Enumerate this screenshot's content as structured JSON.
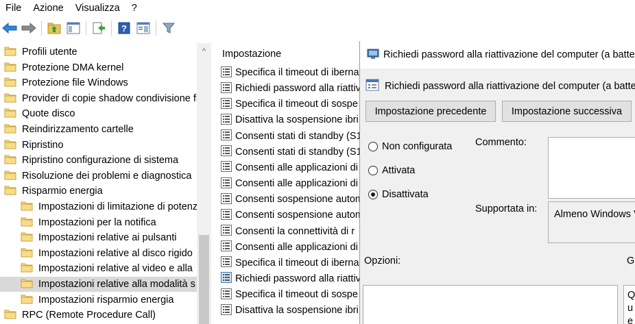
{
  "menu": [
    "File",
    "Azione",
    "Visualizza",
    "?"
  ],
  "toolbar_icons": [
    "back-arrow-icon",
    "forward-arrow-icon",
    "up-folder-icon",
    "show-hide-tree-icon",
    "export-list-icon",
    "help-icon",
    "properties-icon",
    "filter-icon"
  ],
  "tree": {
    "items": [
      {
        "label": "Profili utente",
        "indent": 0
      },
      {
        "label": "Protezione DMA kernel",
        "indent": 0
      },
      {
        "label": "Protezione file Windows",
        "indent": 0
      },
      {
        "label": "Provider di copie shadow condivisione file",
        "indent": 0
      },
      {
        "label": "Quote disco",
        "indent": 0
      },
      {
        "label": "Reindirizzamento cartelle",
        "indent": 0
      },
      {
        "label": "Ripristino",
        "indent": 0
      },
      {
        "label": "Ripristino configurazione di sistema",
        "indent": 0
      },
      {
        "label": "Risoluzione dei problemi e diagnostica",
        "indent": 0
      },
      {
        "label": "Risparmio energia",
        "indent": 0
      },
      {
        "label": "Impostazioni di limitazione di potenza",
        "indent": 1
      },
      {
        "label": "Impostazioni per la notifica",
        "indent": 1
      },
      {
        "label": "Impostazioni relative ai pulsanti",
        "indent": 1
      },
      {
        "label": "Impostazioni relative al disco rigido",
        "indent": 1
      },
      {
        "label": "Impostazioni relative al video e alla",
        "indent": 1
      },
      {
        "label": "Impostazioni relative alla modalità s",
        "indent": 1,
        "selected": true
      },
      {
        "label": "Impostazioni risparmio energia",
        "indent": 1
      },
      {
        "label": "RPC (Remote Procedure Call)",
        "indent": 0
      }
    ]
  },
  "list": {
    "header": "Impostazione",
    "items": [
      {
        "label": "Specifica il timeout di iberna"
      },
      {
        "label": "Richiedi password alla riattiv"
      },
      {
        "label": "Specifica il timeout di sospe"
      },
      {
        "label": "Disattiva la sospensione ibri"
      },
      {
        "label": "Consenti stati di standby (S1"
      },
      {
        "label": "Consenti stati di standby (S1"
      },
      {
        "label": "Consenti alle applicazioni di"
      },
      {
        "label": "Consenti alle applicazioni di"
      },
      {
        "label": "Consenti sospensione autom"
      },
      {
        "label": "Consenti sospensione autom"
      },
      {
        "label": "Consenti la connettività di r"
      },
      {
        "label": "Consenti alle applicazioni di"
      },
      {
        "label": "Specifica il timeout di iberna"
      },
      {
        "label": "Richiedi password alla riattiv",
        "highlight": true
      },
      {
        "label": "Specifica il timeout di sospe"
      },
      {
        "label": "Disattiva la sospensione ibri"
      }
    ]
  },
  "dialog": {
    "title": "Richiedi password alla riattivazione del computer (a batteria)",
    "subtitle": "Richiedi password alla riattivazione del computer (a batteria)",
    "prev_button": "Impostazione precedente",
    "next_button": "Impostazione successiva",
    "radios": [
      {
        "label": "Non configurata",
        "checked": false
      },
      {
        "label": "Attivata",
        "checked": false
      },
      {
        "label": "Disattivata",
        "checked": true
      }
    ],
    "comment_label": "Commento:",
    "supported_label": "Supportata in:",
    "supported_value": "Almeno Windows Vista",
    "options_label": "Opzioni:",
    "help_label": "Guida:",
    "help_text": "Questa impostazione dei criteri consente di specificare"
  }
}
